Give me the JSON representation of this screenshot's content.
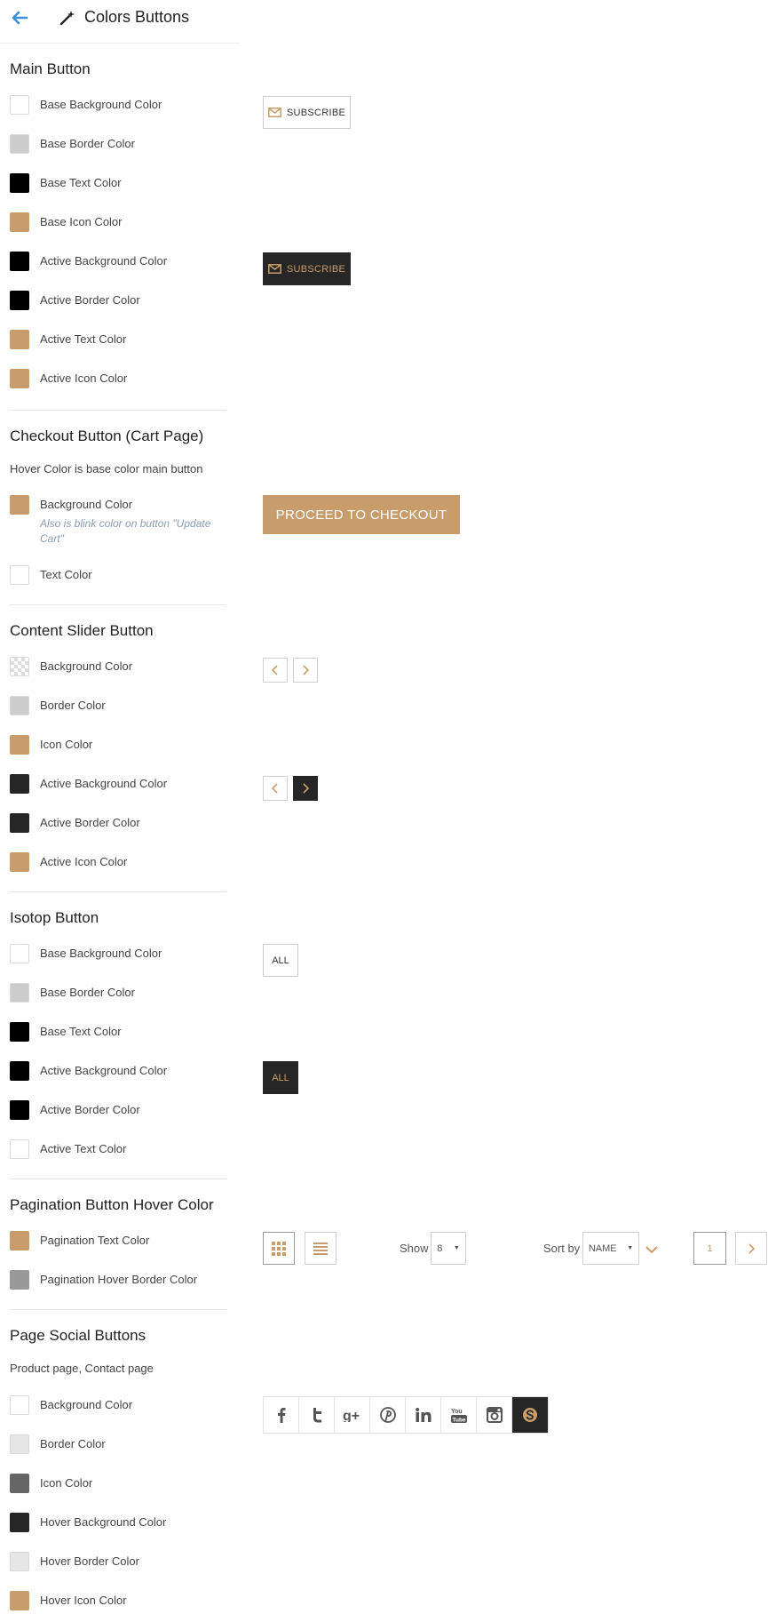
{
  "header": {
    "title": "Colors Buttons"
  },
  "colors": {
    "accent": "#c89d6b",
    "dark": "#262626",
    "black": "#000000",
    "white": "#ffffff",
    "gray": "#cccccc",
    "mid_gray": "#999999",
    "light_gray": "#e6e6e6",
    "icon_gray": "#666666"
  },
  "main_button": {
    "title": "Main Button",
    "items": [
      {
        "label": "Base Background Color"
      },
      {
        "label": "Base Border Color"
      },
      {
        "label": "Base Text Color"
      },
      {
        "label": "Base Icon Color"
      },
      {
        "label": "Active Background Color"
      },
      {
        "label": "Active Border Color"
      },
      {
        "label": "Active Text Color"
      },
      {
        "label": "Active Icon Color"
      }
    ],
    "preview_label": "SUBSCRIBE"
  },
  "checkout_button": {
    "title": "Checkout Button (Cart Page)",
    "desc": "Hover Color is base color main button",
    "items": [
      {
        "label": "Background Color",
        "note": "Also is blink color on button \"Update Cart\""
      },
      {
        "label": "Text Color"
      }
    ],
    "preview_label": "PROCEED TO CHECKOUT"
  },
  "slider_button": {
    "title": "Content Slider Button",
    "items": [
      {
        "label": "Background Color"
      },
      {
        "label": "Border Color"
      },
      {
        "label": "Icon Color"
      },
      {
        "label": "Active Background Color"
      },
      {
        "label": "Active Border Color"
      },
      {
        "label": "Active Icon Color"
      }
    ]
  },
  "isotop_button": {
    "title": "Isotop Button",
    "items": [
      {
        "label": "Base Background Color"
      },
      {
        "label": "Base Border Color"
      },
      {
        "label": "Base Text Color"
      },
      {
        "label": "Active Background Color"
      },
      {
        "label": "Active Border Color"
      },
      {
        "label": "Active Text Color"
      }
    ],
    "preview_label": "ALL"
  },
  "pagination": {
    "title": "Pagination Button Hover Color",
    "items": [
      {
        "label": "Pagination Text Color"
      },
      {
        "label": "Pagination Hover Border Color"
      }
    ],
    "show_label": "Show",
    "show_value": "8",
    "sort_label": "Sort by",
    "sort_value": "NAME",
    "page": "1"
  },
  "social": {
    "title": "Page Social Buttons",
    "desc": "Product page, Contact page",
    "items": [
      {
        "label": "Background Color"
      },
      {
        "label": "Border Color"
      },
      {
        "label": "Icon Color"
      },
      {
        "label": "Hover Background Color"
      },
      {
        "label": "Hover Border Color"
      },
      {
        "label": "Hover Icon Color"
      }
    ],
    "icons": [
      "facebook-icon",
      "twitter-icon",
      "google-plus-icon",
      "pinterest-icon",
      "linkedin-icon",
      "youtube-icon",
      "instagram-icon",
      "skype-icon"
    ]
  }
}
